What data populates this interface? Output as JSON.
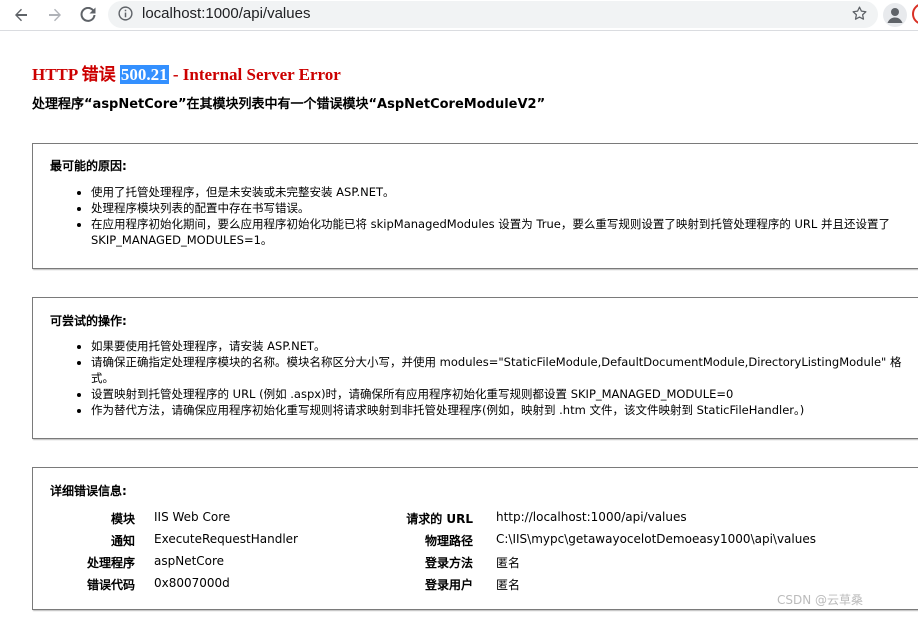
{
  "browser": {
    "url": "localhost:1000/api/values"
  },
  "error": {
    "title_prefix": "HTTP 错误 ",
    "title_code": "500.21",
    "title_suffix": " - Internal Server Error",
    "subtitle": "处理程序“aspNetCore”在其模块列表中有一个错误模块“AspNetCoreModuleV2”"
  },
  "causes": {
    "heading": "最可能的原因:",
    "items": [
      "使用了托管处理程序，但是未安装或未完整安装 ASP.NET。",
      "处理程序模块列表的配置中存在书写错误。",
      "在应用程序初始化期间，要么应用程序初始化功能已将 skipManagedModules 设置为 True，要么重写规则设置了映射到托管处理程序的 URL 并且还设置了 SKIP_MANAGED_MODULES=1。"
    ]
  },
  "actions": {
    "heading": "可尝试的操作:",
    "items": [
      "如果要使用托管处理程序，请安装 ASP.NET。",
      "请确保正确指定处理程序模块的名称。模块名称区分大小写，并使用 modules=\"StaticFileModule,DefaultDocumentModule,DirectoryListingModule\" 格式。",
      "设置映射到托管处理程序的 URL (例如 .aspx)时，请确保所有应用程序初始化重写规则都设置 SKIP_MANAGED_MODULE=0",
      "作为替代方法，请确保应用程序初始化重写规则将请求映射到非托管处理程序(例如，映射到 .htm 文件，该文件映射到 StaticFileHandler。)"
    ]
  },
  "details": {
    "heading": "详细错误信息:",
    "left": [
      {
        "label": "模块",
        "value": "IIS Web Core"
      },
      {
        "label": "通知",
        "value": "ExecuteRequestHandler"
      },
      {
        "label": "处理程序",
        "value": "aspNetCore"
      },
      {
        "label": "错误代码",
        "value": "0x8007000d"
      }
    ],
    "right": [
      {
        "label": "请求的 URL",
        "value": "http://localhost:1000/api/values"
      },
      {
        "label": "物理路径",
        "value": "C:\\IIS\\mypc\\getawayocelotDemoeasy1000\\api\\values"
      },
      {
        "label": "登录方法",
        "value": "匿名"
      },
      {
        "label": "登录用户",
        "value": "匿名"
      }
    ]
  },
  "watermark": "CSDN @云草桑"
}
